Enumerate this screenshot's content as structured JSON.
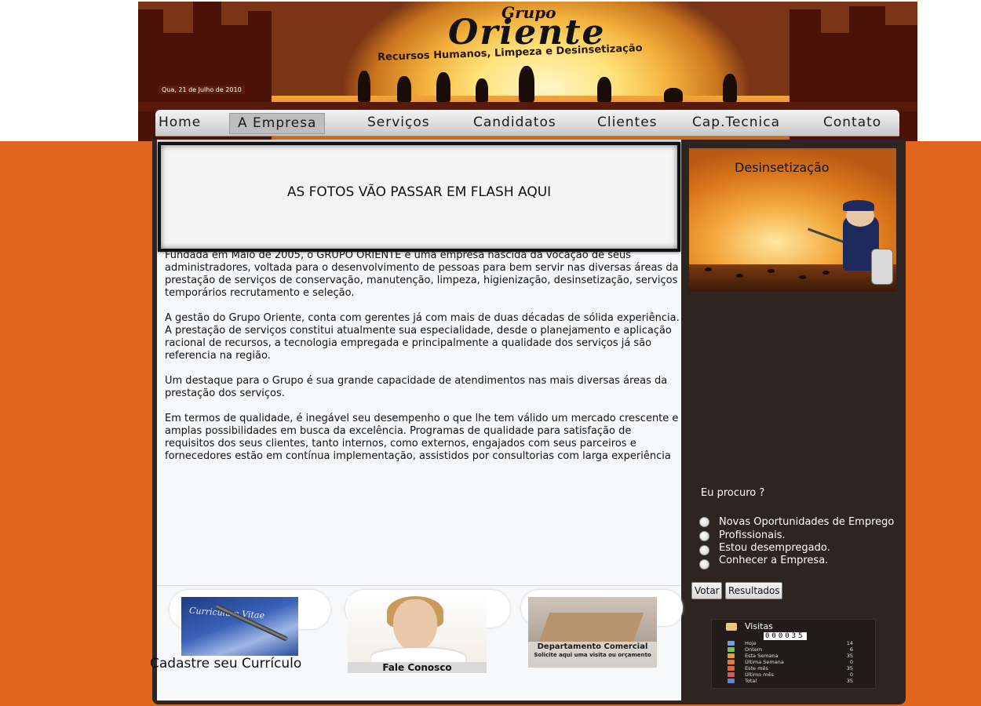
{
  "header": {
    "logo_top": "Grupo",
    "logo_main": "Oriente",
    "tagline": "Recursos Humanos, Limpeza e Desinsetização",
    "date": "Qua, 21 de Julho de 2010"
  },
  "nav": {
    "items": [
      "Home",
      "A Empresa",
      "Serviços",
      "Candidatos",
      "Clientes",
      "Cap.Tecnica",
      "Contato"
    ],
    "active": "A Empresa"
  },
  "main": {
    "flash_text": "AS FOTOS VÃO PASSAR EM FLASH AQUI",
    "paragraphs": [
      "Fundada em Maio de 2005, o GRUPO ORIENTE é uma empresa nascida da vocação de seus administradores, voltada para o desenvolvimento de pessoas para bem servir nas diversas áreas da prestação de serviços de conservação, manutenção, limpeza, higienização, desinsetização, serviços temporários recrutamento e seleção.",
      "A gestão do Grupo Oriente, conta com gerentes já com mais de duas décadas de sólida experiência. A prestação de serviços constitui atualmente sua especialidade, desde o planejamento e aplicação racional de recursos, a tecnologia empregada e principalmente a qualidade dos serviços já são referencia na região.",
      "Um destaque para o Grupo é sua grande capacidade de atendimentos nas mais diversas áreas da prestação dos serviços.",
      "Em termos de qualidade, é inegável seu desempenho o que lhe tem válido um mercado crescente e amplas possibilidades em busca da excelência. Programas de qualidade para satisfação de requisitos dos seus clientes, tanto internos, como externos, engajados com seus parceiros e fornecedores estão em contínua implementação, assistidos por consultorias com larga experiência"
    ]
  },
  "cards": {
    "cv_image_text": "Curriculum Vitae",
    "cv_label": "Cadastre seu Currículo",
    "contact_label": "Fale Conosco",
    "commercial_title": "Departamento Comercial",
    "commercial_sub": "Solicite aqui uma visita ou orçamento"
  },
  "sidebar": {
    "banner_title": "Desinsetização",
    "poll": {
      "question": "Eu procuro ?",
      "options": [
        "Novas Oportunidades de Emprego",
        "Profissionais.",
        "Estou desempregado.",
        "Conhecer a Empresa."
      ],
      "vote_label": "Votar",
      "results_label": "Resultados"
    },
    "visits": {
      "title": "Visitas",
      "counter": "000035",
      "rows": [
        {
          "label": "Hoje",
          "value": "14",
          "color": "#6aa0e8"
        },
        {
          "label": "Ontem",
          "value": "6",
          "color": "#7ac04a"
        },
        {
          "label": "Esta Semana",
          "value": "35",
          "color": "#e0a030"
        },
        {
          "label": "Última Semana",
          "value": "0",
          "color": "#e07a30"
        },
        {
          "label": "Este mês",
          "value": "35",
          "color": "#e06a30"
        },
        {
          "label": "Último mês",
          "value": "0",
          "color": "#d05a5a"
        },
        {
          "label": "Total",
          "value": "35",
          "color": "#5a8ad0"
        }
      ]
    }
  }
}
